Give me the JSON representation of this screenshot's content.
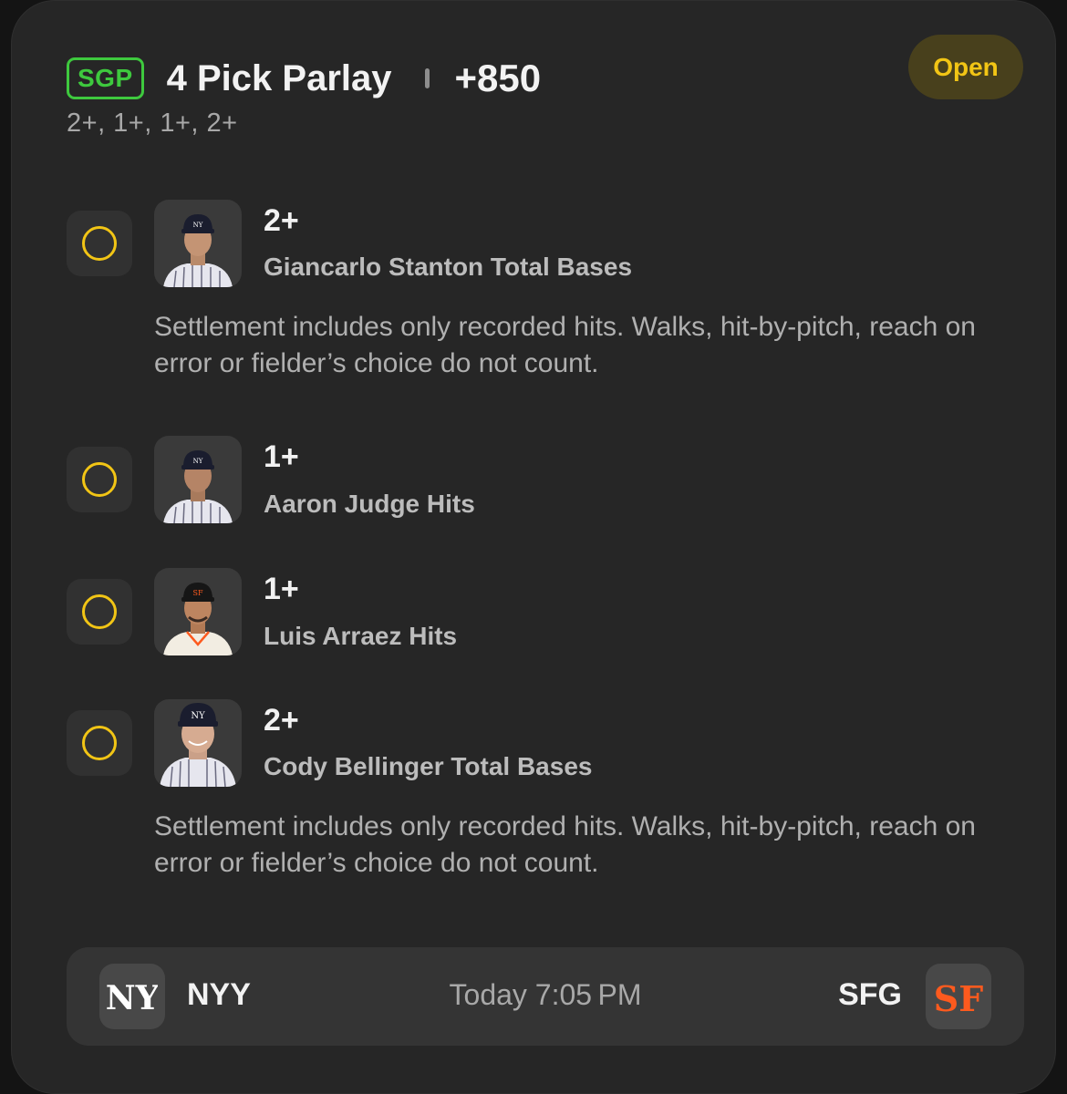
{
  "header": {
    "badge": "SGP",
    "title": "4 Pick Parlay",
    "odds": "+850",
    "subtitle": "2+, 1+, 1+, 2+",
    "status": "Open"
  },
  "legs": [
    {
      "line": "2+",
      "market": "Giancarlo Stanton Total Bases",
      "note": "Settlement includes only recorded hits. Walks, hit-by-pitch, reach on error or fielder’s choice do not count."
    },
    {
      "line": "1+",
      "market": "Aaron Judge Hits"
    },
    {
      "line": "1+",
      "market": "Luis Arraez Hits"
    },
    {
      "line": "2+",
      "market": "Cody Bellinger Total Bases",
      "note": "Settlement includes only recorded hits. Walks, hit-by-pitch, reach on error or fielder’s choice do not count."
    }
  ],
  "footer": {
    "home_team": "NYY",
    "away_team": "SFG",
    "time": "Today 7:05 PM"
  },
  "colors": {
    "accent_yellow": "#f2c515",
    "sgp_green": "#3ec93e",
    "giants_orange": "#fd5a1e"
  }
}
